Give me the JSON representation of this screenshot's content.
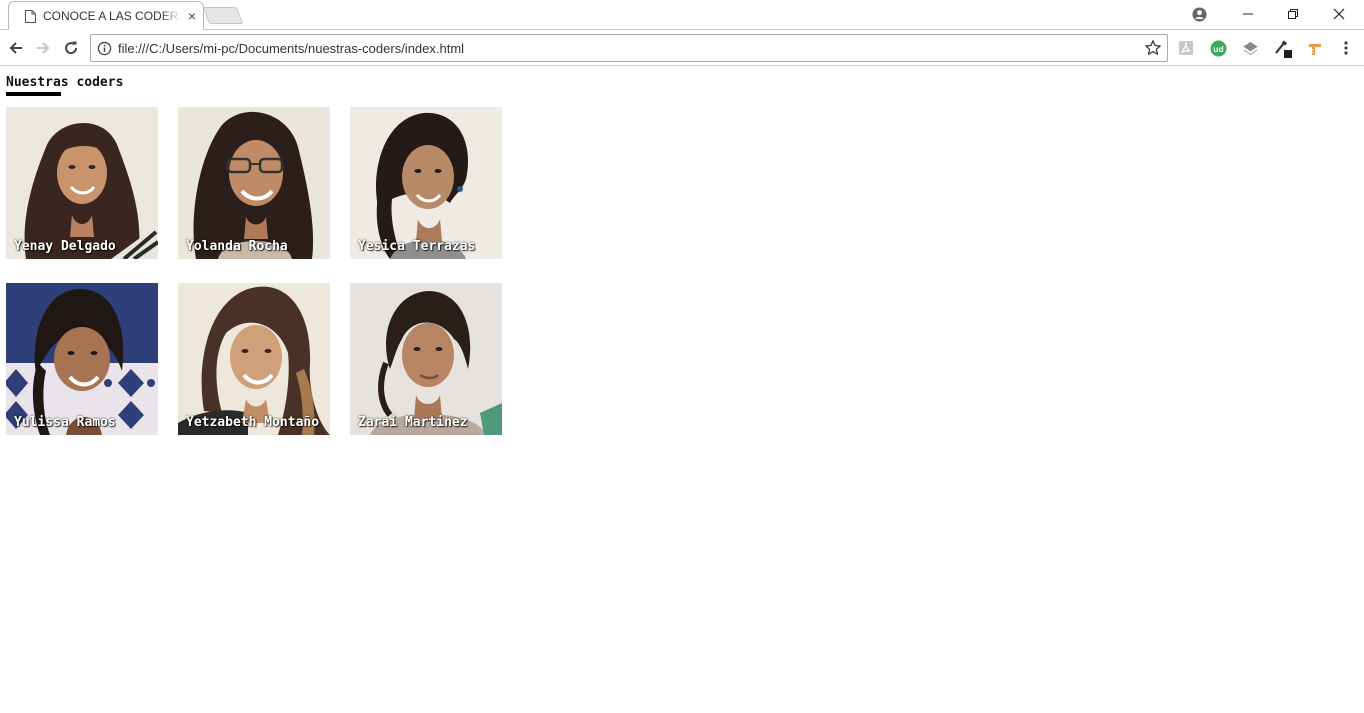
{
  "browser": {
    "tab": {
      "title": "CONOCE A LAS CODERS",
      "close_icon": "×"
    },
    "address": {
      "url": "file:///C:/Users/mi-pc/Documents/nuestras-coders/index.html"
    },
    "extensions": [
      "pdf-icon",
      "ud-icon",
      "layers-icon",
      "color-picker-icon",
      "ruler-icon",
      "menu-icon"
    ]
  },
  "page": {
    "heading": "Nuestras coders",
    "coders": [
      {
        "name": "Yenay Delgado"
      },
      {
        "name": "Yolanda Rocha"
      },
      {
        "name": "Yesica Terrazas"
      },
      {
        "name": "Yulissa Ramos"
      },
      {
        "name": "Yetzabeth Montaño"
      },
      {
        "name": "Zaraí Martinez"
      }
    ]
  },
  "colors": {
    "accent_green": "#3aaa5c",
    "underline": "#000000",
    "photo_bg": "#ece6dc"
  }
}
